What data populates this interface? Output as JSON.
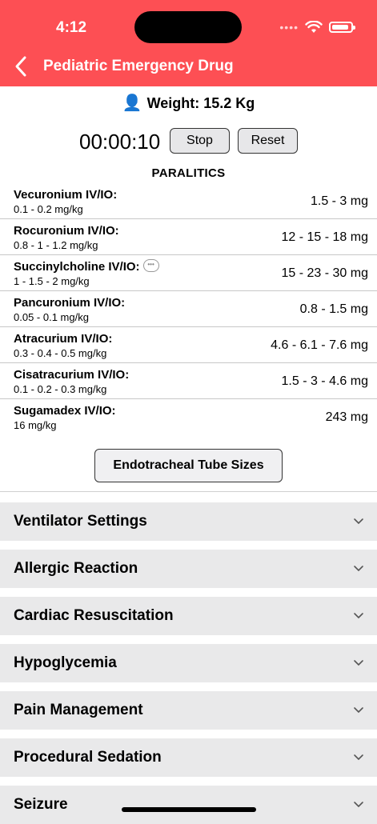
{
  "status": {
    "time": "4:12"
  },
  "nav": {
    "title": "Pediatric Emergency Drug"
  },
  "weight": {
    "text": "Weight: 15.2 Kg"
  },
  "timer": {
    "display": "00:00:10",
    "stop_label": "Stop",
    "reset_label": "Reset"
  },
  "section": {
    "title": "PARALITICS"
  },
  "drugs": [
    {
      "name": "Vecuronium  IV/IO:",
      "dose": "0.1 - 0.2 mg/kg",
      "total": "1.5 - 3 mg"
    },
    {
      "name": "Rocuronium IV/IO:",
      "dose": "0.8 - 1 - 1.2 mg/kg",
      "total": "12 - 15 - 18 mg"
    },
    {
      "name": "Succinylcholine IV/IO:",
      "dose": "1 - 1.5 - 2 mg/kg",
      "total": "15 - 23 - 30 mg"
    },
    {
      "name": "Pancuronium IV/IO:",
      "dose": "0.05 - 0.1 mg/kg",
      "total": "0.8 - 1.5 mg"
    },
    {
      "name": "Atracurium IV/IO:",
      "dose": "0.3 - 0.4 - 0.5 mg/kg",
      "total": "4.6 - 6.1 - 7.6 mg"
    },
    {
      "name": "Cisatracurium IV/IO:",
      "dose": "0.1 - 0.2 - 0.3 mg/kg",
      "total": "1.5 - 3 - 4.6 mg"
    },
    {
      "name": "Sugamadex IV/IO:",
      "dose": "16 mg/kg",
      "total": "243 mg"
    }
  ],
  "ett": {
    "label": "Endotracheal Tube Sizes"
  },
  "sections": [
    {
      "label": "Ventilator Settings"
    },
    {
      "label": "Allergic Reaction"
    },
    {
      "label": "Cardiac Resuscitation"
    },
    {
      "label": "Hypoglycemia"
    },
    {
      "label": "Pain Management"
    },
    {
      "label": "Procedural Sedation"
    },
    {
      "label": "Seizure"
    }
  ],
  "colors": {
    "header": "#fd4f54",
    "accordion": "#e9e9ea"
  },
  "icons": {
    "back": "chevron-left-icon",
    "expand": "chevron-down-icon",
    "weight": "person-icon",
    "note": "chat-bubble-icon"
  }
}
